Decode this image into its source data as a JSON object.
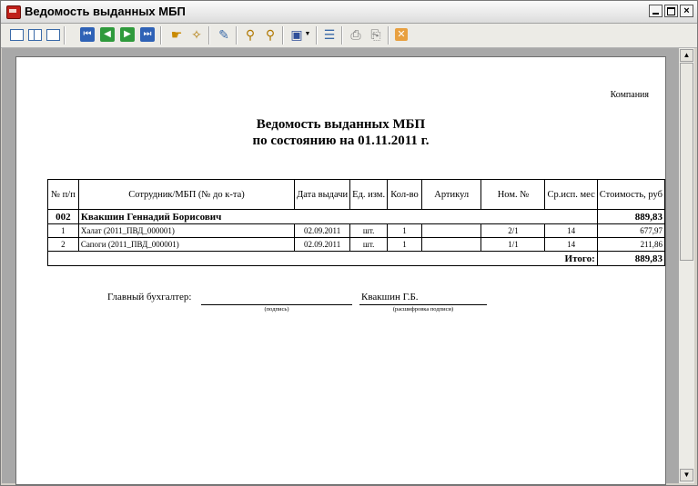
{
  "window": {
    "title": "Ведомость выданных МБП",
    "close_glyph": "×"
  },
  "toolbar": {
    "icons": [
      "page-view-icon",
      "two-page-view-icon",
      "page-setup-icon",
      "first-page-icon",
      "prev-page-icon",
      "next-page-icon",
      "last-page-icon",
      "bookmarks-icon",
      "find-icon",
      "edit-icon",
      "zoom-in-icon",
      "zoom-out-icon",
      "save-icon",
      "tree-icon",
      "print-icon",
      "print-setup-icon",
      "close-preview-icon"
    ],
    "nav_glyphs": {
      "first": "⏮",
      "prev": "◀",
      "next": "▶",
      "last": "⏭"
    }
  },
  "report": {
    "company": "Компания",
    "title_line1": "Ведомость выданных МБП",
    "title_line2": "по состоянию на 01.11.2011 г.",
    "headers": {
      "num": "№ п/п",
      "employee": "Сотрудник/МБП (№ до к-та)",
      "date": "Дата выдачи",
      "unit": "Ед. изм.",
      "qty": "Кол-во",
      "article": "Артикул",
      "nom": "Ном. №",
      "life": "Ср.исп. мес",
      "cost": "Стоимость, руб"
    },
    "group": {
      "code": "002",
      "name": "Квакшин Геннадий Борисович",
      "total": "889,83"
    },
    "rows": [
      {
        "n": "1",
        "name": "Халат (2011_ПВД_000001)",
        "date": "02.09.2011",
        "unit": "шт.",
        "qty": "1",
        "article": "",
        "nom": "2/1",
        "life": "14",
        "cost": "677,97"
      },
      {
        "n": "2",
        "name": "Сапоги (2011_ПВД_000001)",
        "date": "02.09.2011",
        "unit": "шт.",
        "qty": "1",
        "article": "",
        "nom": "1/1",
        "life": "14",
        "cost": "211,86"
      }
    ],
    "total_label": "Итого:",
    "total_value": "889,83",
    "signature": {
      "label": "Главный бухгалтер:",
      "name": "Квакшин Г.Б.",
      "caption_sign": "(подпись)",
      "caption_decode": "(расшифровка подписи)"
    }
  },
  "scrollbar": {
    "up": "▲",
    "down": "▼"
  }
}
